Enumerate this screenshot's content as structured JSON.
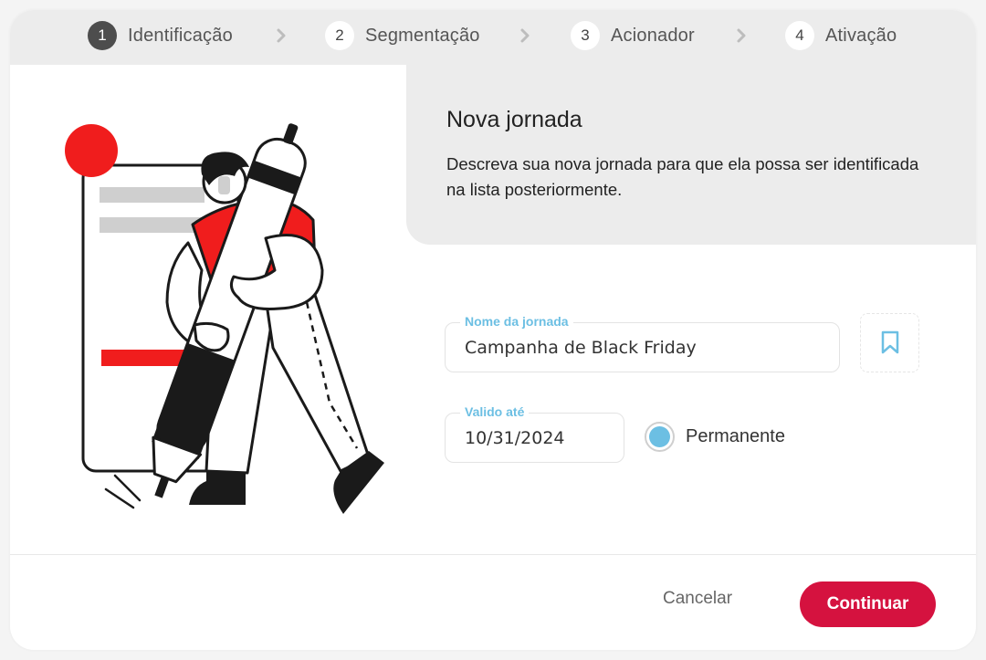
{
  "stepper": {
    "steps": [
      {
        "number": "1",
        "label": "Identificação"
      },
      {
        "number": "2",
        "label": "Segmentação"
      },
      {
        "number": "3",
        "label": "Acionador"
      },
      {
        "number": "4",
        "label": "Ativação"
      }
    ]
  },
  "info": {
    "title": "Nova jornada",
    "description": "Descreva sua nova jornada para que ela possa ser identificada na lista posteriormente."
  },
  "form": {
    "name_label": "Nome da jornada",
    "name_value": "Campanha de Black Friday",
    "valid_label": "Valido até",
    "valid_value": "10/31/2024",
    "permanent_label": "Permanente"
  },
  "footer": {
    "cancel_label": "Cancelar",
    "continue_label": "Continuar"
  },
  "colors": {
    "accent": "#d5123f",
    "field_label": "#6cbfe3",
    "illustration_red": "#f01d1d"
  },
  "icons": {
    "chevron": "chevron-right-icon",
    "bookmark": "bookmark-icon"
  }
}
